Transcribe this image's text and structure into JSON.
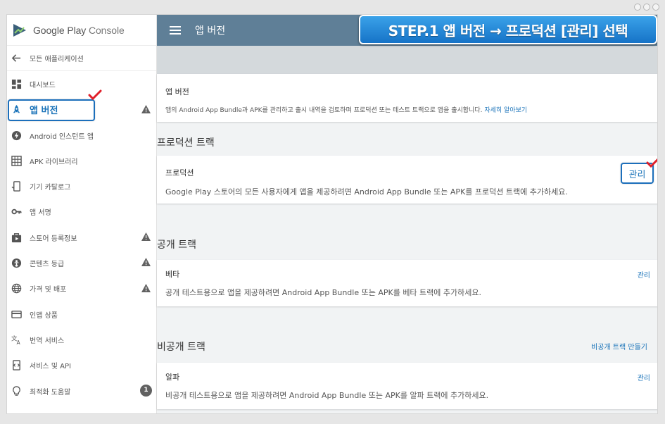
{
  "app": {
    "name_main": "Google Play",
    "name_sub": "Console"
  },
  "sidebar": {
    "back_label": "모든 애플리케이션",
    "items": [
      {
        "label": "대시보드",
        "icon": "dashboard-icon",
        "warning": false
      },
      {
        "label": "앱 버전",
        "icon": "rocket-icon",
        "warning": true,
        "active": true
      },
      {
        "label": "Android 인스턴트 앱",
        "icon": "bolt-icon",
        "warning": false
      },
      {
        "label": "APK 라이브러리",
        "icon": "library-icon",
        "warning": false
      },
      {
        "label": "기기 카탈로그",
        "icon": "device-icon",
        "warning": false
      },
      {
        "label": "앱 서명",
        "icon": "key-icon",
        "warning": false
      },
      {
        "label": "스토어 등록정보",
        "icon": "store-icon",
        "warning": true
      },
      {
        "label": "콘텐츠 등급",
        "icon": "rating-icon",
        "warning": true
      },
      {
        "label": "가격 및 배포",
        "icon": "globe-icon",
        "warning": true
      },
      {
        "label": "인앱 상품",
        "icon": "card-icon",
        "warning": false
      },
      {
        "label": "번역 서비스",
        "icon": "translate-icon",
        "warning": false
      },
      {
        "label": "서비스 및 API",
        "icon": "api-icon",
        "warning": false
      },
      {
        "label": "최적화 도움말",
        "icon": "bulb-icon",
        "warning": false,
        "badge": "1"
      }
    ]
  },
  "topbar": {
    "title": "앱 버전"
  },
  "step_banner": "STEP.1 앱 버전 → 프로덕션 [관리] 선택",
  "intro_card": {
    "title": "앱 버전",
    "desc": "앱의 Android App Bundle과 APK를 관리하고 출시 내역을 검토하며 프로덕션 또는 테스트 트랙으로 앱을 출시합니다.",
    "link": "자세히 알아보기"
  },
  "production": {
    "section_title": "프로덕션 트랙",
    "card_title": "프로덕션",
    "desc": "Google Play 스토어의 모든 사용자에게 앱을 제공하려면 Android App Bundle 또는 APK를 프로덕션 트랙에 추가하세요.",
    "manage": "관리"
  },
  "open_track": {
    "section_title": "공개 트랙",
    "card_title": "베타",
    "desc": "공개 테스트용으로 앱을 제공하려면 Android App Bundle 또는 APK를 베타 트랙에 추가하세요.",
    "manage": "관리"
  },
  "closed_track": {
    "section_title": "비공개 트랙",
    "create_link": "비공개 트랙 만들기",
    "card_title": "알파",
    "desc": "비공개 테스트용으로 앱을 제공하려면 Android App Bundle 또는 APK를 알파 트랙에 추가하세요.",
    "manage": "관리"
  },
  "colors": {
    "accent": "#1a73b9",
    "topbar": "#5f7f97",
    "warning": "#616161",
    "check": "#e0202a"
  }
}
